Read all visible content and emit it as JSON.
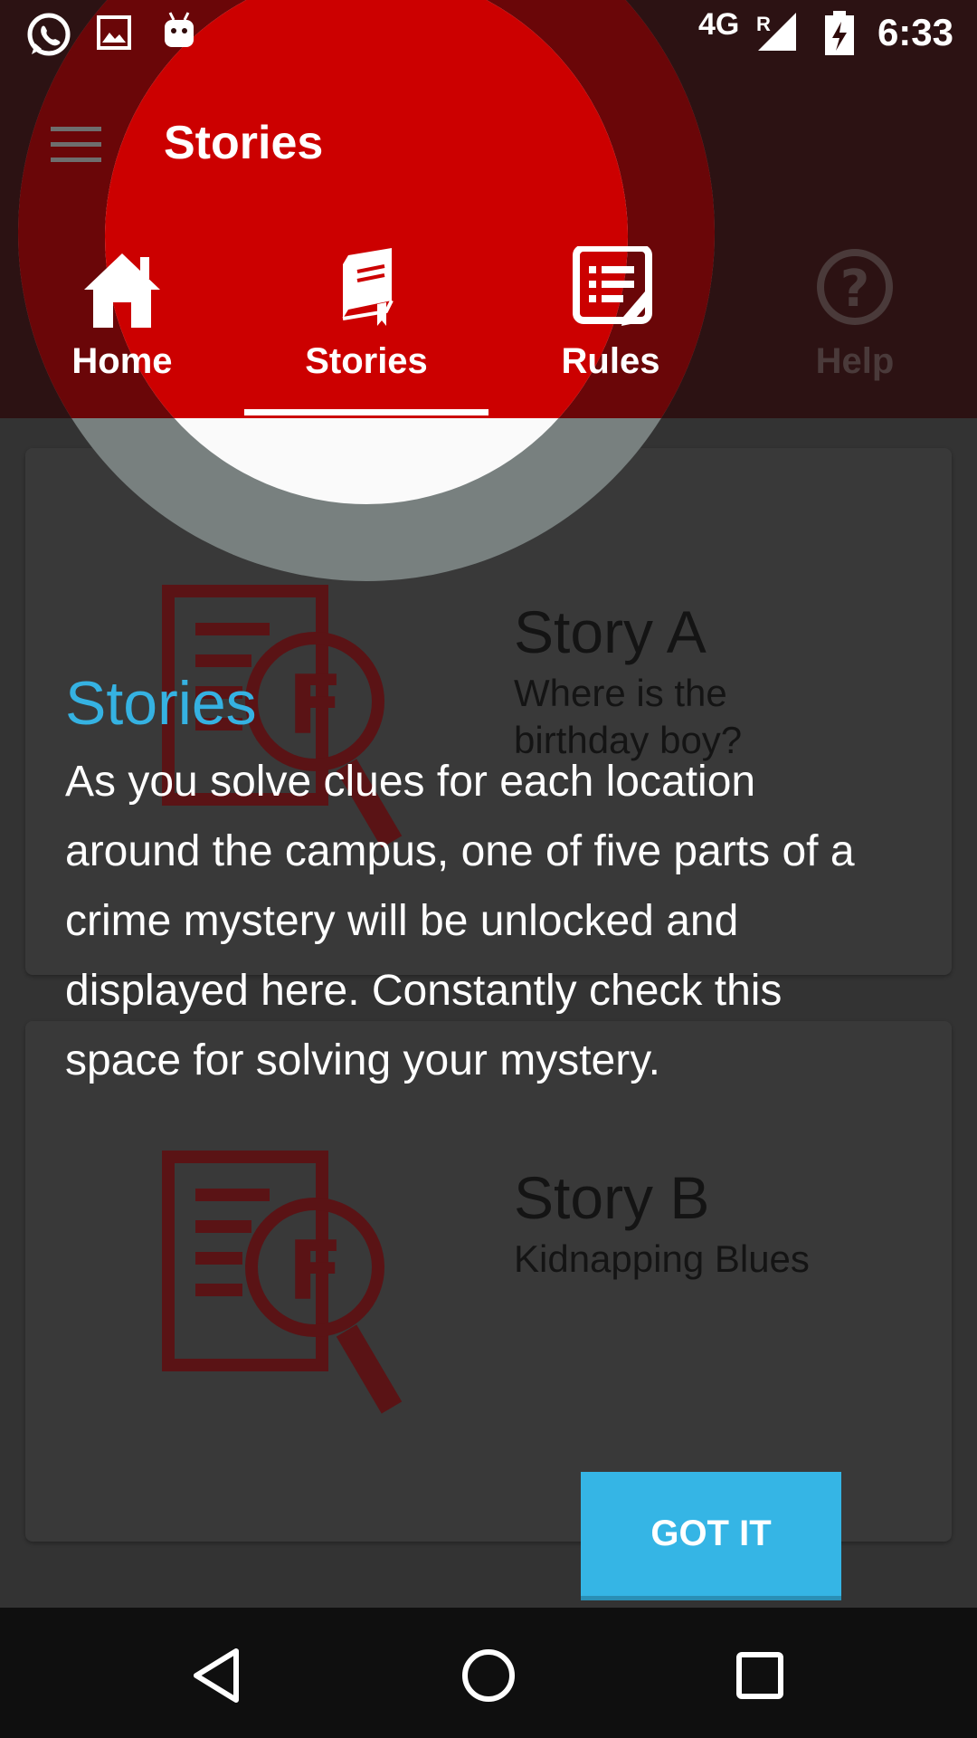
{
  "status_bar": {
    "network": "4G",
    "roaming": "R",
    "time": "6:33",
    "icons": [
      "whatsapp-icon",
      "gallery-icon",
      "android-icon",
      "signal-icon",
      "battery-charging-icon"
    ]
  },
  "app_bar": {
    "title": "Stories",
    "menu_icon": "hamburger-menu-icon"
  },
  "tabs": [
    {
      "label": "Home",
      "icon": "home-icon",
      "selected": false
    },
    {
      "label": "Stories",
      "icon": "book-icon",
      "selected": true
    },
    {
      "label": "Rules",
      "icon": "rules-icon",
      "selected": false
    },
    {
      "label": "Help",
      "icon": "help-icon",
      "selected": false
    }
  ],
  "stories": [
    {
      "title": "Story A",
      "subtitle": "Where is the birthday boy?",
      "icon": "detective-file-icon"
    },
    {
      "title": "Story B",
      "subtitle": "Kidnapping Blues",
      "icon": "detective-file-icon"
    }
  ],
  "tutorial": {
    "title": "Stories",
    "body": "As you solve clues for each location around the campus, one of five parts of a crime mystery will be unlocked and displayed here. Constantly check this space for solving your mystery.",
    "button": "GOT IT"
  },
  "colors": {
    "app_bar": "#cc0000",
    "accent": "#35b5e5",
    "overlay": "#333333"
  },
  "nav_bar": {
    "icons": [
      "back-icon",
      "home-circle-icon",
      "recents-icon"
    ]
  }
}
